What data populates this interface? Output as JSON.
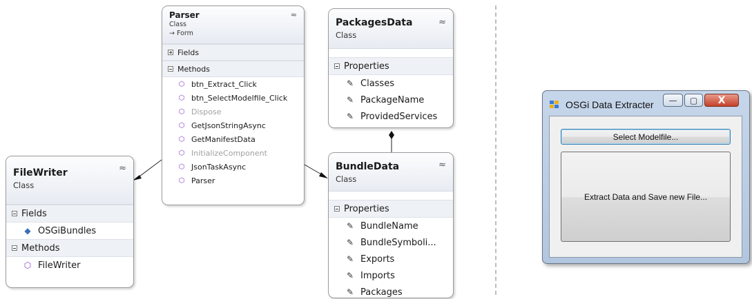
{
  "diagram": {
    "classes": [
      {
        "id": "parser",
        "name": "Parser",
        "stereotype": "Class",
        "base": "→ Form",
        "sections": [
          {
            "label": "Fields",
            "collapsed": true,
            "members": []
          },
          {
            "label": "Methods",
            "collapsed": false,
            "members": [
              {
                "name": "btn_Extract_Click",
                "icon": "private-method-icon",
                "dim": false
              },
              {
                "name": "btn_SelectModelfile_Click",
                "icon": "private-method-icon",
                "dim": false
              },
              {
                "name": "Dispose",
                "icon": "protected-method-icon",
                "dim": true
              },
              {
                "name": "GetJsonStringAsync",
                "icon": "method-icon",
                "dim": false
              },
              {
                "name": "GetManifestData",
                "icon": "private-method-icon",
                "dim": false
              },
              {
                "name": "InitializeComponent",
                "icon": "private-method-icon",
                "dim": true
              },
              {
                "name": "JsonTaskAsync",
                "icon": "method-icon",
                "dim": false
              },
              {
                "name": "Parser",
                "icon": "method-icon",
                "dim": false
              }
            ]
          }
        ]
      },
      {
        "id": "packagesdata",
        "name": "PackagesData",
        "stereotype": "Class",
        "base": "",
        "sections": [
          {
            "label": "Properties",
            "collapsed": false,
            "members": [
              {
                "name": "Classes",
                "icon": "property-wrench-icon",
                "dim": false
              },
              {
                "name": "PackageName",
                "icon": "property-wrench-icon",
                "dim": false
              },
              {
                "name": "ProvidedServices",
                "icon": "property-wrench-icon",
                "dim": false
              }
            ]
          }
        ]
      },
      {
        "id": "filewriter",
        "name": "FileWriter",
        "stereotype": "Class",
        "base": "",
        "sections": [
          {
            "label": "Fields",
            "collapsed": false,
            "members": [
              {
                "name": "OSGiBundles",
                "icon": "private-field-icon",
                "dim": false
              }
            ]
          },
          {
            "label": "Methods",
            "collapsed": false,
            "members": [
              {
                "name": "FileWriter",
                "icon": "method-icon",
                "dim": false
              }
            ]
          }
        ]
      },
      {
        "id": "bundledata",
        "name": "BundleData",
        "stereotype": "Class",
        "base": "",
        "sections": [
          {
            "label": "Properties",
            "collapsed": false,
            "members": [
              {
                "name": "BundleName",
                "icon": "property-wrench-icon",
                "dim": false
              },
              {
                "name": "BundleSymboli...",
                "icon": "property-wrench-icon",
                "dim": false
              },
              {
                "name": "Exports",
                "icon": "property-wrench-icon",
                "dim": false
              },
              {
                "name": "Imports",
                "icon": "property-wrench-icon",
                "dim": false
              },
              {
                "name": "Packages",
                "icon": "property-wrench-icon",
                "dim": false
              }
            ]
          }
        ]
      }
    ],
    "collapse_glyph": "≈"
  },
  "window": {
    "title": "OSGi Data Extracter",
    "controls": {
      "minimize": "—",
      "maximize": "▢",
      "close": "X"
    },
    "select_button_label": "Select Modelfile...",
    "extract_button_label": "Extract Data and Save new File..."
  },
  "colors": {
    "method_icon": "#8a3cc8",
    "field_icon": "#3a6fb5",
    "window_frame": "#b2c6df",
    "close_button": "#c5422a"
  }
}
